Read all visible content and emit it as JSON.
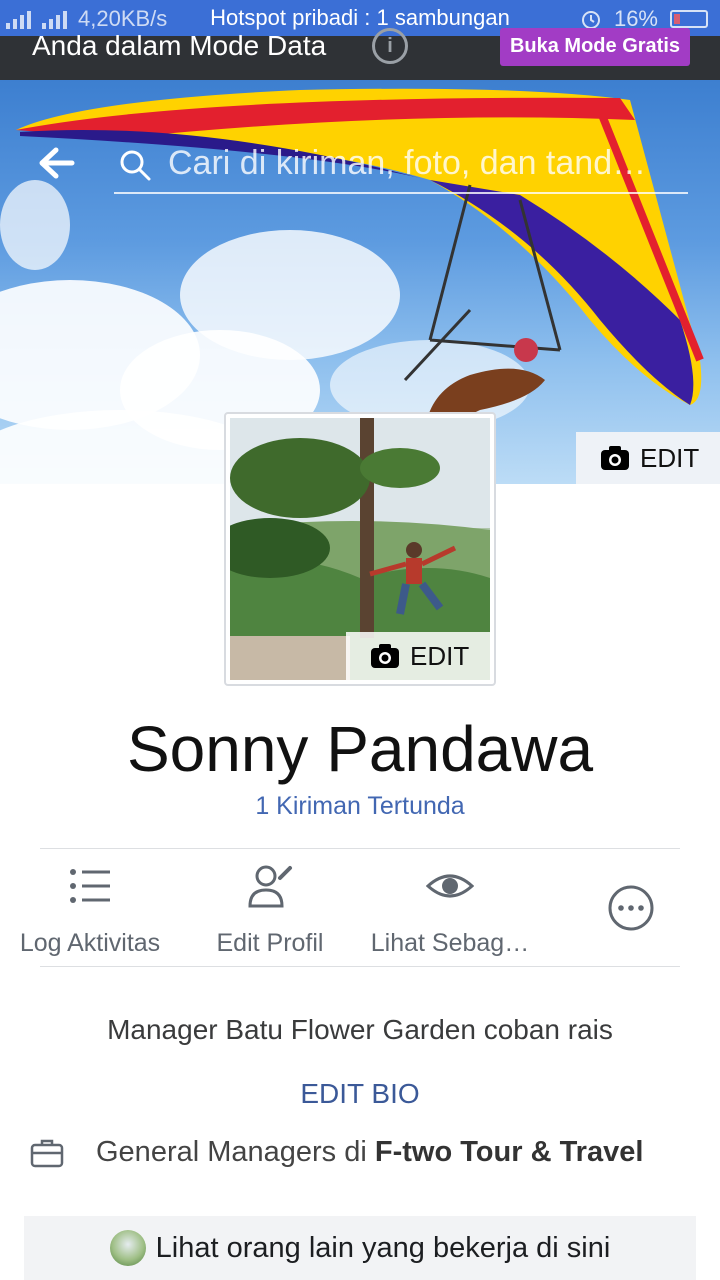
{
  "status_bar": {
    "network": "4G",
    "speed": "4,20KB/s",
    "notification": "Hotspot pribadi : 1 sambungan",
    "battery": "16%"
  },
  "data_banner": {
    "text": "Anda dalam Mode Data",
    "free_mode_button": "Buka Mode Gratis"
  },
  "search": {
    "placeholder": "Cari di kiriman, foto, dan tand…"
  },
  "cover": {
    "edit_label": "EDIT"
  },
  "profile_picture": {
    "edit_label": "EDIT"
  },
  "profile": {
    "name": "Sonny Pandawa",
    "pending_posts": "1 Kiriman Tertunda"
  },
  "actions": [
    {
      "label": "Log Aktivitas",
      "icon": "list-icon"
    },
    {
      "label": "Edit Profil",
      "icon": "edit-profile-icon"
    },
    {
      "label": "Lihat Sebag…",
      "icon": "eye-icon"
    },
    {
      "label": "",
      "icon": "more-icon"
    }
  ],
  "bio": {
    "text": "Manager Batu Flower Garden coban rais",
    "edit_label": "EDIT BIO"
  },
  "work": {
    "role": "General Managers di ",
    "company": "F-two Tour & Travel"
  },
  "coworkers": {
    "label": "Lihat orang lain yang bekerja di sini"
  },
  "colors": {
    "status_bar": "#3b6fd6",
    "data_banner": "#2f3236",
    "free_mode_button": "#a23cc5",
    "link": "#4267b2"
  }
}
